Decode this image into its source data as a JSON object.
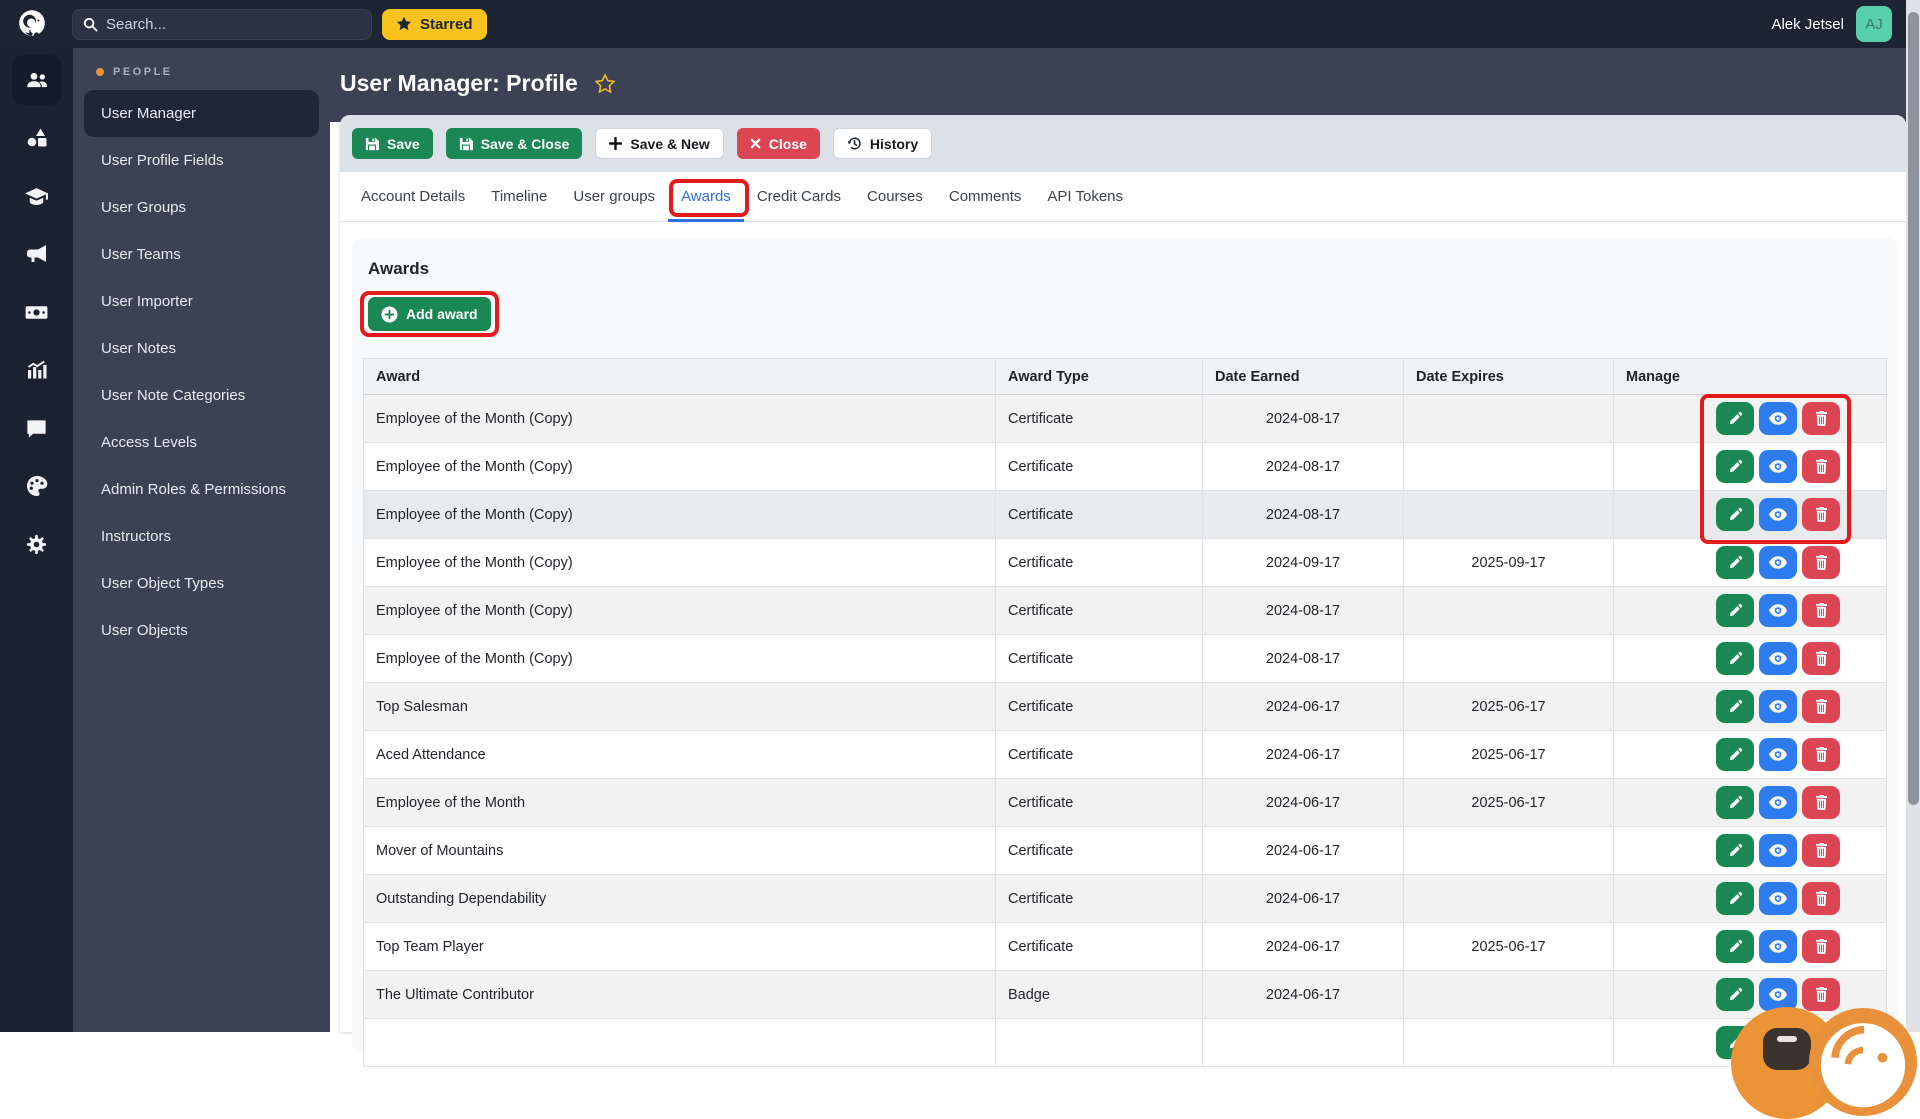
{
  "topbar": {
    "search_placeholder": "Search...",
    "starred_label": "Starred",
    "user_name": "Alek Jetsel",
    "user_initials": "AJ"
  },
  "sidebar": {
    "section_label": "PEOPLE",
    "rail_icons": [
      "users",
      "shapes",
      "graduation-cap",
      "megaphone",
      "money-bill",
      "chart-column",
      "comment",
      "palette",
      "gear"
    ],
    "items": [
      {
        "label": "User Manager",
        "active": true
      },
      {
        "label": "User Profile Fields"
      },
      {
        "label": "User Groups"
      },
      {
        "label": "User Teams"
      },
      {
        "label": "User Importer"
      },
      {
        "label": "User Notes"
      },
      {
        "label": "User Note Categories"
      },
      {
        "label": "Access Levels"
      },
      {
        "label": "Admin Roles & Permissions"
      },
      {
        "label": "Instructors"
      },
      {
        "label": "User Object Types"
      },
      {
        "label": "User Objects"
      }
    ]
  },
  "header": {
    "title": "User Manager: Profile"
  },
  "toolbar": {
    "save": "Save",
    "save_close": "Save & Close",
    "save_new": "Save & New",
    "close": "Close",
    "history": "History"
  },
  "tabs": [
    {
      "label": "Account Details"
    },
    {
      "label": "Timeline"
    },
    {
      "label": "User groups"
    },
    {
      "label": "Awards",
      "active": true,
      "annotated": true
    },
    {
      "label": "Credit Cards"
    },
    {
      "label": "Courses"
    },
    {
      "label": "Comments"
    },
    {
      "label": "API Tokens"
    }
  ],
  "awards_section": {
    "heading": "Awards",
    "add_button_label": "Add award"
  },
  "table": {
    "columns": [
      "Award",
      "Award Type",
      "Date Earned",
      "Date Expires",
      "Manage"
    ],
    "rows": [
      {
        "award": "Employee of the Month (Copy)",
        "type": "Certificate",
        "earned": "2024-08-17",
        "expires": ""
      },
      {
        "award": "Employee of the Month (Copy)",
        "type": "Certificate",
        "earned": "2024-08-17",
        "expires": ""
      },
      {
        "award": "Employee of the Month (Copy)",
        "type": "Certificate",
        "earned": "2024-08-17",
        "expires": "",
        "state": "hovered"
      },
      {
        "award": "Employee of the Month (Copy)",
        "type": "Certificate",
        "earned": "2024-09-17",
        "expires": "2025-09-17"
      },
      {
        "award": "Employee of the Month (Copy)",
        "type": "Certificate",
        "earned": "2024-08-17",
        "expires": ""
      },
      {
        "award": "Employee of the Month (Copy)",
        "type": "Certificate",
        "earned": "2024-08-17",
        "expires": ""
      },
      {
        "award": "Top Salesman",
        "type": "Certificate",
        "earned": "2024-06-17",
        "expires": "2025-06-17"
      },
      {
        "award": "Aced Attendance",
        "type": "Certificate",
        "earned": "2024-06-17",
        "expires": "2025-06-17"
      },
      {
        "award": "Employee of the Month",
        "type": "Certificate",
        "earned": "2024-06-17",
        "expires": "2025-06-17"
      },
      {
        "award": "Mover of Mountains",
        "type": "Certificate",
        "earned": "2024-06-17",
        "expires": ""
      },
      {
        "award": "Outstanding Dependability",
        "type": "Certificate",
        "earned": "2024-06-17",
        "expires": ""
      },
      {
        "award": "Top Team Player",
        "type": "Certificate",
        "earned": "2024-06-17",
        "expires": "2025-06-17"
      },
      {
        "award": "The Ultimate Contributor",
        "type": "Badge",
        "earned": "2024-06-17",
        "expires": ""
      },
      {
        "award": "",
        "type": "",
        "earned": "",
        "expires": ""
      }
    ]
  },
  "colors": {
    "navbar": "#1d2533",
    "sidebar_rail": "#1b2230",
    "sidebar_panel": "#3a4253",
    "accent_green": "#1a8754",
    "accent_blue": "#2e7bf0",
    "accent_red": "#dc4653",
    "annotation_red": "#e31b1b",
    "starred_yellow": "#f6c21b",
    "avatar_teal": "#57d0ac",
    "brand_orange": "#e8913a",
    "active_tab_blue": "#2e6ee0"
  }
}
